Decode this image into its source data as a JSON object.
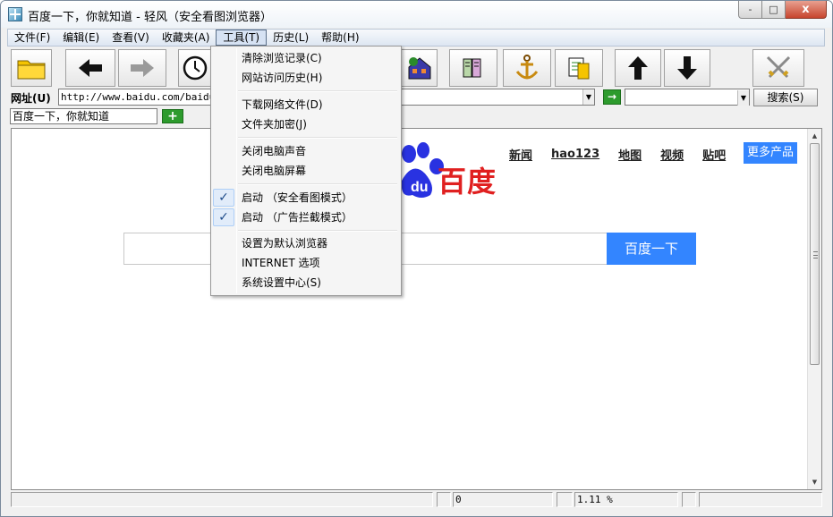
{
  "window": {
    "title": "百度一下，你就知道 - 轻风（安全看图浏览器）",
    "controls": {
      "minimize": "-",
      "maximize": "□",
      "close": "x"
    }
  },
  "menubar": {
    "items": [
      "文件(F)",
      "编辑(E)",
      "查看(V)",
      "收藏夹(A)",
      "工具(T)",
      "历史(L)",
      "帮助(H)"
    ],
    "active_index": 4
  },
  "toolbar": {
    "buttons": [
      "folder-icon",
      "back-arrow-icon",
      "forward-arrow-icon",
      "clock-icon",
      "home-icon",
      "book-icon",
      "anchor-icon",
      "documents-icon",
      "up-arrow-icon",
      "down-arrow-icon",
      "swords-icon"
    ]
  },
  "address": {
    "label": "网址(U)",
    "url": "http://www.baidu.com/baidu.h",
    "search_button": "搜索(S)",
    "go_label": "→"
  },
  "tab": {
    "title": "百度一下，你就知道",
    "new_tab": "+"
  },
  "page": {
    "nav_links": [
      "新闻",
      "hao123",
      "地图",
      "视频",
      "贴吧"
    ],
    "more_products": "更多产品",
    "logo_text": "百度",
    "search_button": "百度一下"
  },
  "tools_menu": {
    "groups": [
      [
        {
          "label": "清除浏览记录(C)",
          "checked": false
        },
        {
          "label": "网站访问历史(H)",
          "checked": false
        }
      ],
      [
        {
          "label": "下载网络文件(D)",
          "checked": false
        },
        {
          "label": "文件夹加密(J)",
          "checked": false
        }
      ],
      [
        {
          "label": "关闭电脑声音",
          "checked": false
        },
        {
          "label": "关闭电脑屏幕",
          "checked": false
        }
      ],
      [
        {
          "label": "启动 （安全看图模式）",
          "checked": true
        },
        {
          "label": "启动 （广告拦截模式）",
          "checked": true
        }
      ],
      [
        {
          "label": "设置为默认浏览器",
          "checked": false
        },
        {
          "label": "INTERNET 选项",
          "checked": false
        },
        {
          "label": "系统设置中心(S)",
          "checked": false
        }
      ]
    ]
  },
  "statusbar": {
    "cells": [
      "",
      "",
      "0",
      "",
      "1.11 %",
      "",
      ""
    ]
  },
  "colors": {
    "baidu_blue": "#3385ff",
    "baidu_red": "#e02020",
    "go_green": "#2d9b2d"
  }
}
